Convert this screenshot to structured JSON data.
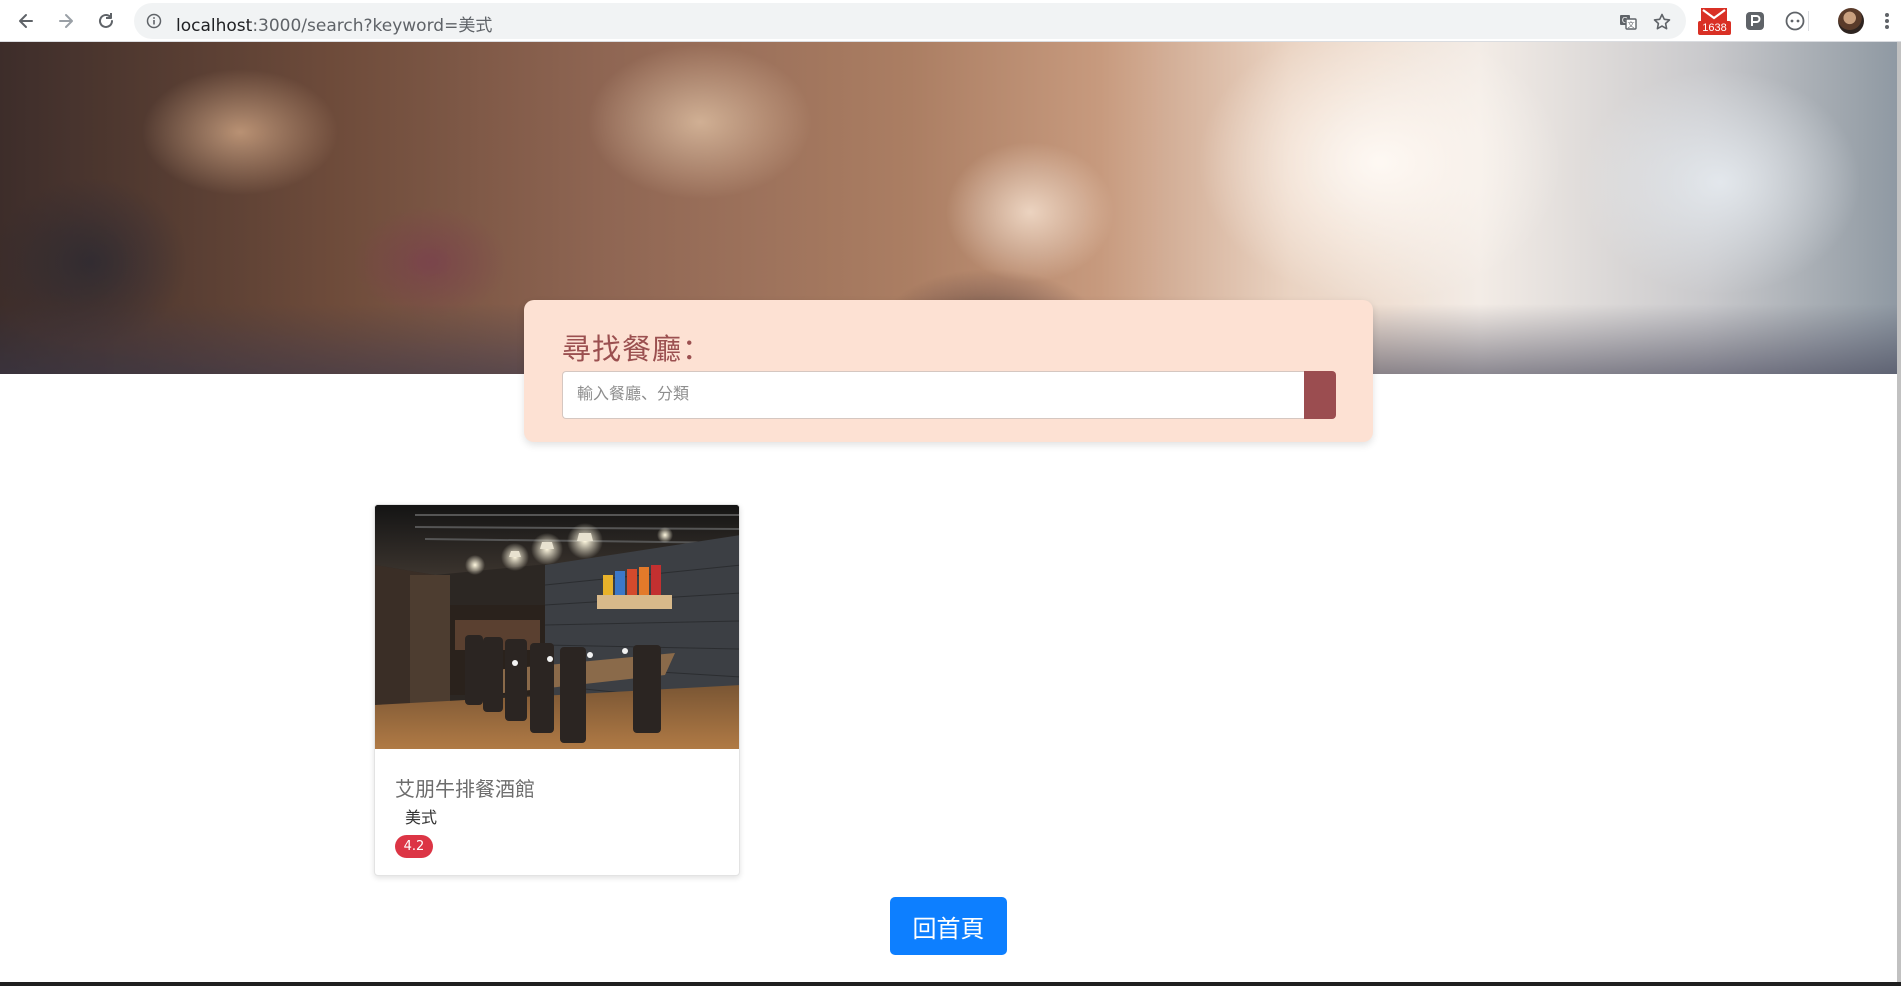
{
  "browser": {
    "url_host": "localhost",
    "url_rest": ":3000/search?keyword=美式",
    "gmail_count": "1638",
    "icons": [
      "back-arrow-icon",
      "forward-arrow-icon",
      "reload-icon",
      "info-icon",
      "translate-icon",
      "star-icon",
      "gmail-icon",
      "extension-p-icon",
      "extension-circle-icon",
      "avatar",
      "menu-kebab-icon"
    ]
  },
  "search": {
    "title": "尋找餐廳：",
    "placeholder": "輸入餐廳、分類",
    "button_color": "#9b4d50",
    "panel_color": "#fde1d3"
  },
  "results": [
    {
      "name": "艾朋牛排餐酒館",
      "category": "美式",
      "rating": "4.2"
    }
  ],
  "footer": {
    "home_label": "回首頁",
    "home_color": "#0d7fff"
  }
}
